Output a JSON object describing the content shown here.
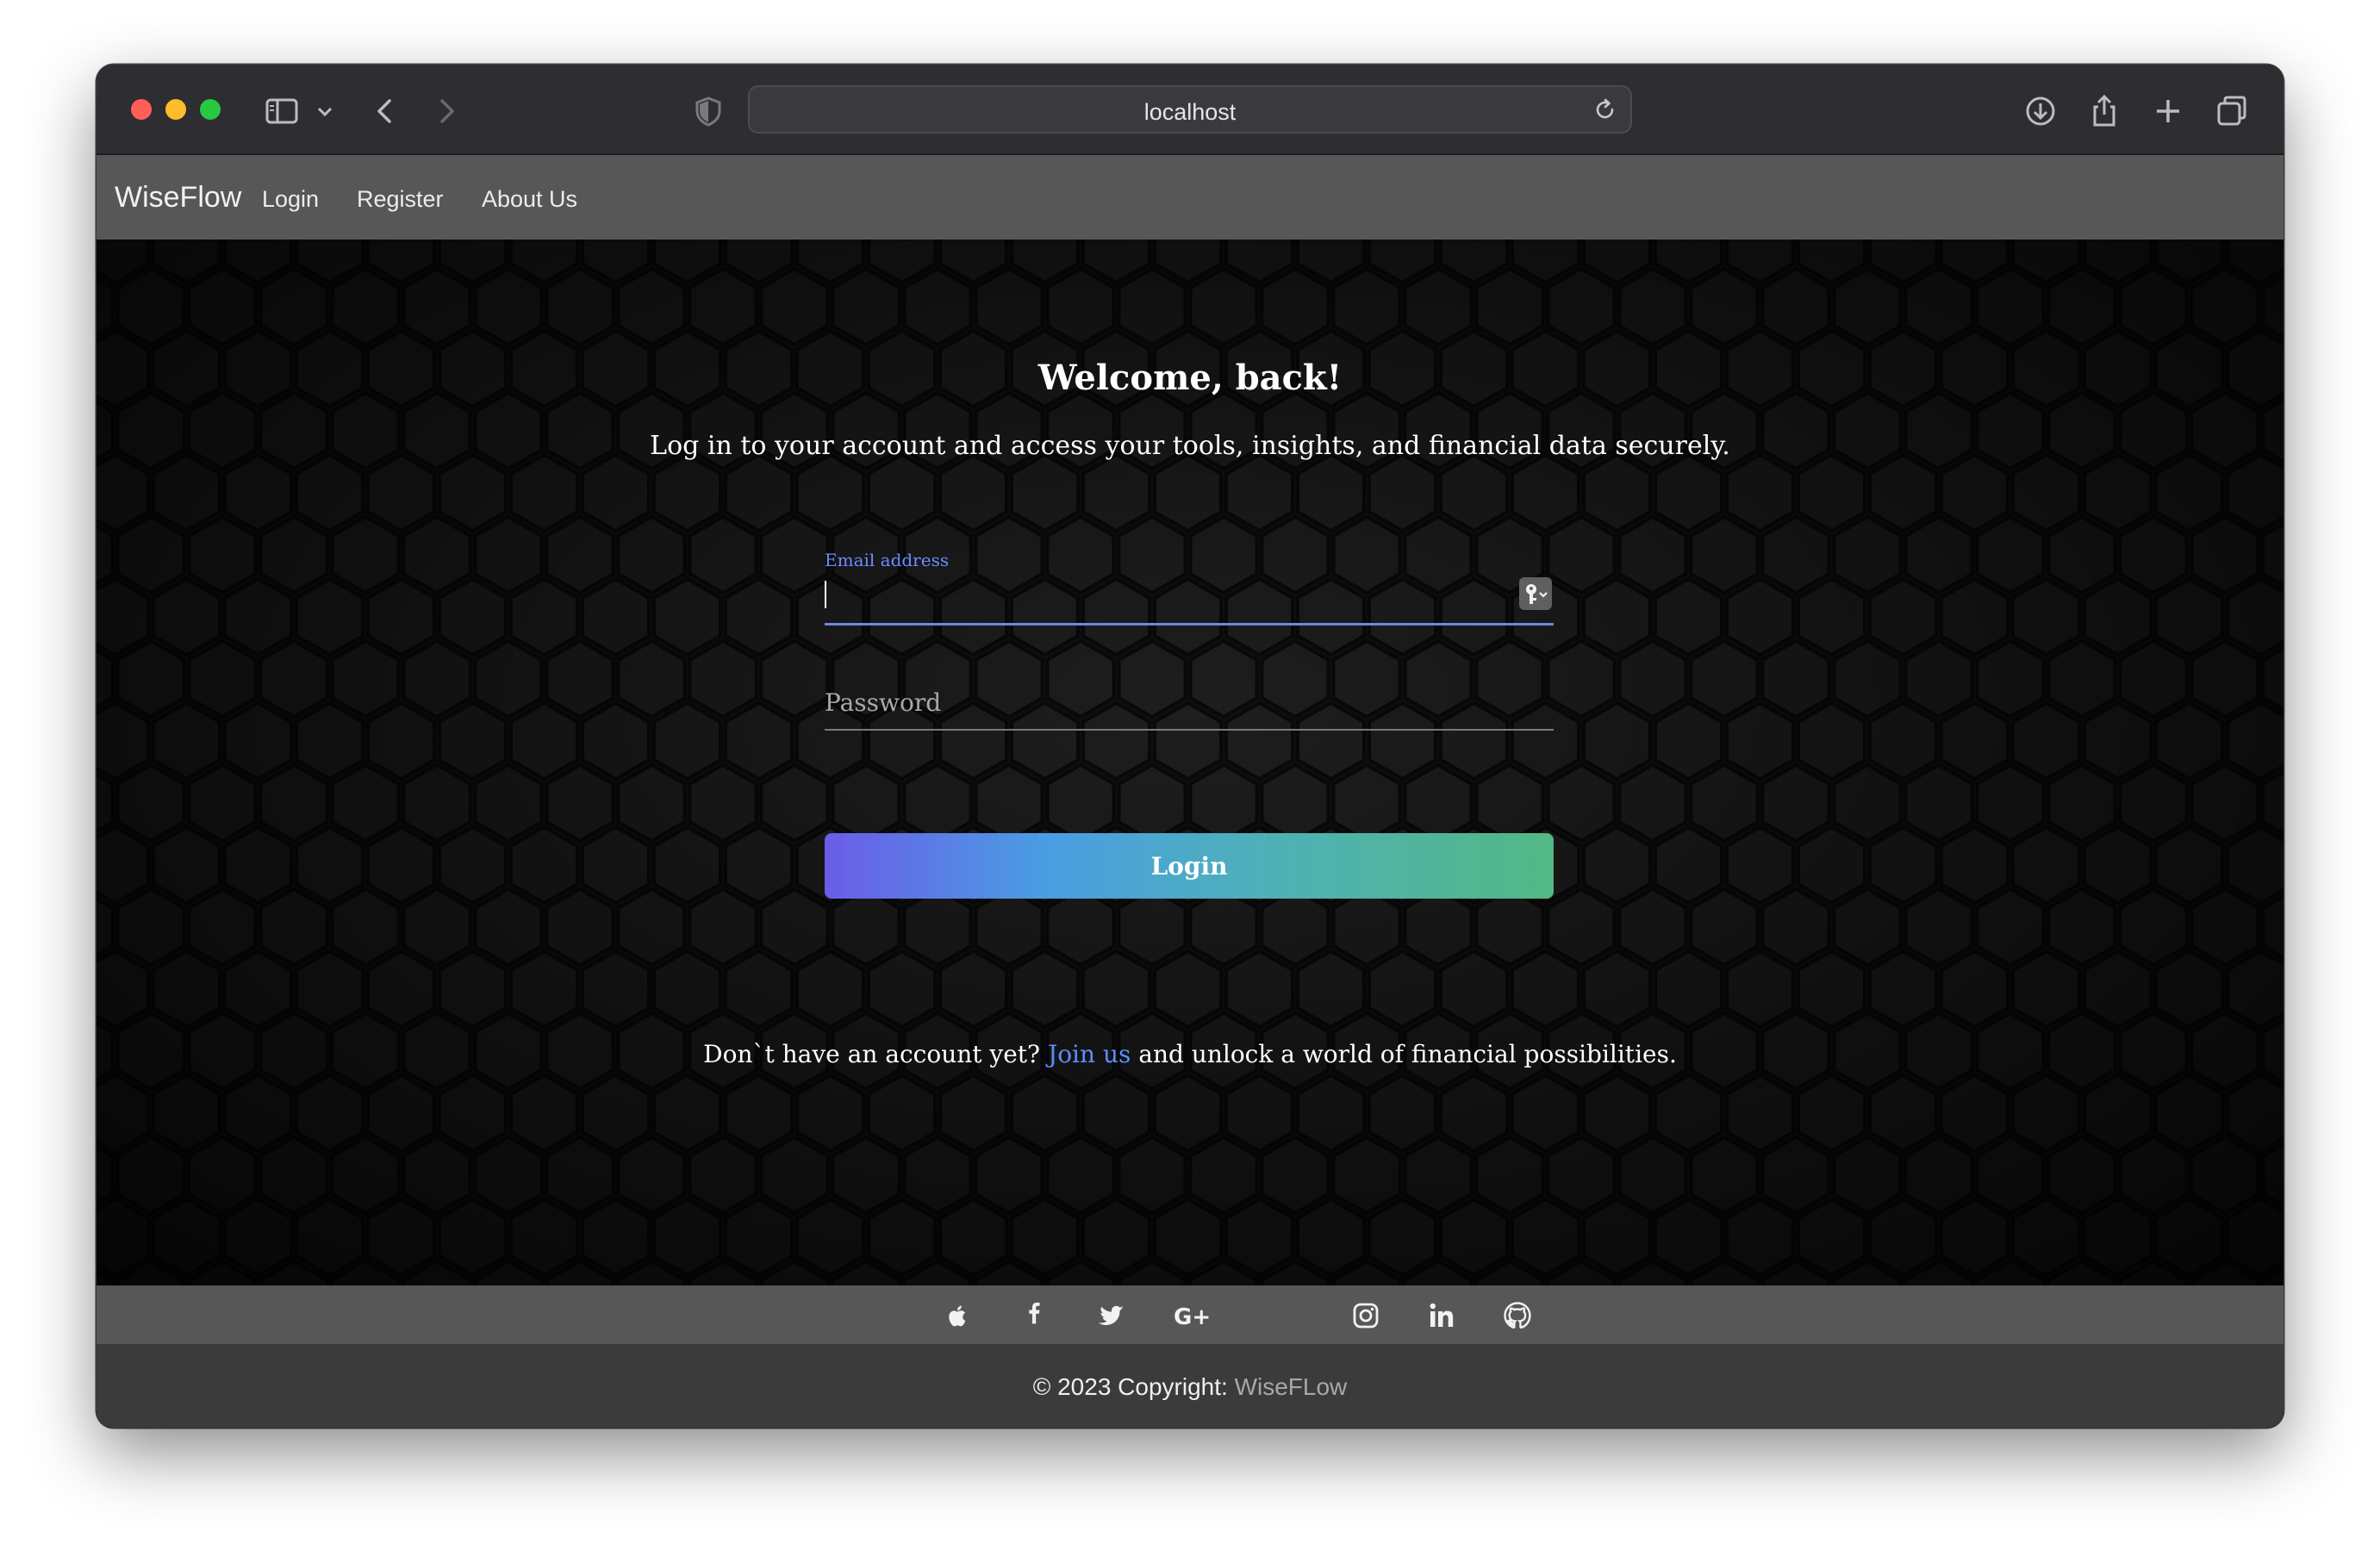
{
  "browser": {
    "url": "localhost",
    "icons": [
      "sidebar-icon",
      "chevron-down-icon",
      "back-icon",
      "forward-icon",
      "shield-icon",
      "reload-icon",
      "download-icon",
      "share-icon",
      "new-tab-icon",
      "tab-overview-icon"
    ]
  },
  "nav": {
    "brand": "WiseFlow",
    "links": [
      "Login",
      "Register",
      "About Us"
    ]
  },
  "login": {
    "title": "Welcome, back!",
    "subtitle": "Log in to your account and access your tools, insights, and financial data securely.",
    "email_label": "Email address",
    "email_value": "",
    "password_placeholder": "Password",
    "button": "Login",
    "signup_prefix": "Don`t have an account yet? ",
    "signup_link": "Join us",
    "signup_suffix": " and unlock a world of financial possibilities."
  },
  "footer": {
    "social": [
      "apple-icon",
      "facebook-icon",
      "twitter-icon",
      "google-plus-icon",
      "instagram-icon",
      "linkedin-icon",
      "github-icon"
    ],
    "copyright_prefix": "© 2023 Copyright: ",
    "copyright_brand": "WiseFLow"
  },
  "colors": {
    "accent": "#5c8dff",
    "nav_bg": "#575757",
    "footer_bg": "#3b3b3b",
    "gradient": [
      "#6b5ce8",
      "#4a9de3",
      "#52b884"
    ]
  }
}
